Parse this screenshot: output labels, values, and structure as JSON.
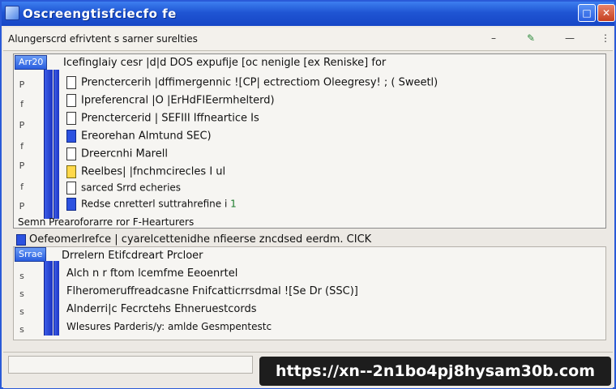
{
  "window": {
    "title": "Oscreengtisfciecfo fe",
    "maximize_glyph": "□",
    "close_glyph": "✕"
  },
  "header": {
    "label": "Alungerscrd efrivtent s sarner surelties",
    "minimize_glyph": "–",
    "pin_glyph": "✎",
    "restore_glyph": "—",
    "more_glyph": "⋮"
  },
  "group1": {
    "tag": "Arr20",
    "heading": "Icefinglaiy cesr |d|d DOS expufije [oc nenigle [ex Reniske] for",
    "rows": [
      {
        "text": "Prenctercerih |dffimergennic ![CP| ectrectiom Oleegresy! ; ( Sweetl)",
        "icon": "plain"
      },
      {
        "text": "Ipreferencral |O |ErHdFIEermhelterd)",
        "icon": "plain"
      },
      {
        "text": "Prenctercerid | SEFIII Iffneartice Is",
        "icon": "plain"
      },
      {
        "text": "Ereorehan Almtund SEC)",
        "icon": "blue"
      },
      {
        "text": "Dreercnhi Marell",
        "icon": "plain"
      },
      {
        "text": "Reelbes| |fnchmcirecles I ul",
        "icon": "yellow"
      },
      {
        "text": "sarced Srrd echeries",
        "icon": "plain"
      },
      {
        "text": "Redse cnretterl suttrahrefine i",
        "icon": "blue",
        "accent": "1"
      }
    ],
    "left_marks": [
      "P",
      "f",
      "P",
      "f",
      "P",
      "f",
      "P",
      "f"
    ],
    "footer": "Semn Prearoforarre ror F-Hearturers",
    "note": "Oefeomerlrefce | cyarelcettenidhe nfieerse zncdsed eerdm. CICK"
  },
  "group2": {
    "tag": "Srrae",
    "heading": "Drrelern Etifcdreart Prcloer",
    "rows": [
      {
        "text": "Alch n r ftom lcemfme Eeoenrtel"
      },
      {
        "text": "Flheromeruffreadcasne Fnifcatticrrsdmal ![Se Dr (SSC)]"
      },
      {
        "text": "Alnderri|c Fecrctehs Ehneruestcords"
      },
      {
        "text": "Wlesures Parderis/y: amlde Gesmpentestc"
      }
    ],
    "left_marks": [
      "s",
      "s",
      "s",
      "s"
    ]
  },
  "overlay": {
    "url": "https://xn--2n1bo4pj8hysam30b.com"
  },
  "colors": {
    "titlebar": "#1f55d3",
    "rail": "#2a45d8",
    "close": "#c5401f"
  }
}
